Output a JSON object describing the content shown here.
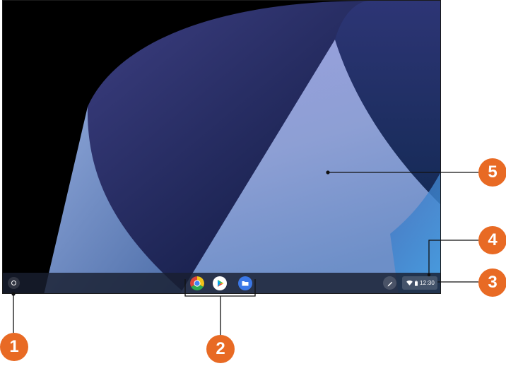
{
  "desktop": {
    "wallpaper_icon": "abstract-curves-wallpaper",
    "colors": {
      "shelf": "#181e30",
      "callout": "#e86a24"
    }
  },
  "shelf": {
    "launcher_icon": "circle-launcher-icon",
    "apps": [
      {
        "icon": "chrome-icon"
      },
      {
        "icon": "play-store-icon"
      },
      {
        "icon": "files-icon"
      }
    ],
    "stylus_icon": "stylus-icon",
    "status_tray": {
      "wifi_icon": "wifi-icon",
      "battery_icon": "battery-icon",
      "time": "12:30"
    }
  },
  "callouts": [
    "1",
    "2",
    "3",
    "4",
    "5"
  ]
}
